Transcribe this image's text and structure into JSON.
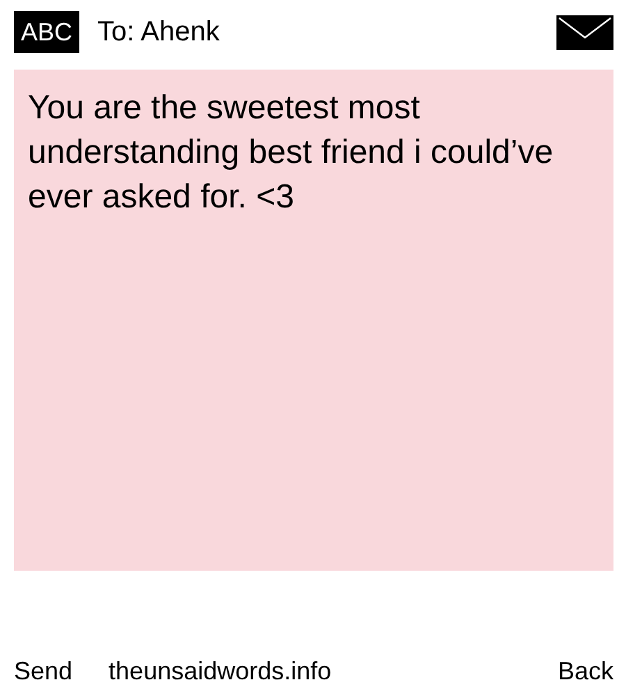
{
  "header": {
    "mode": "ABC",
    "recipient": "To: Ahenk"
  },
  "message": {
    "text": "You are the sweetest most understanding best friend i could’ve ever asked for. <3"
  },
  "footer": {
    "left": "Send",
    "center": "theunsaidwords.info",
    "right": "Back"
  }
}
